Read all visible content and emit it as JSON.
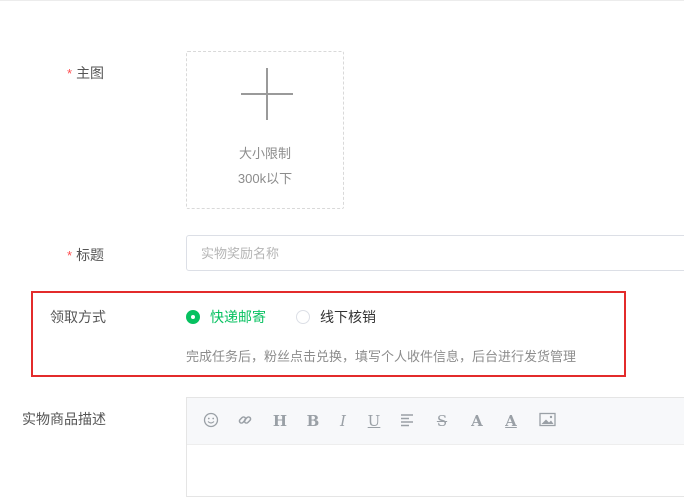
{
  "main_image": {
    "label": "主图",
    "upload": {
      "hint_line1": "大小限制",
      "hint_line2": "300k以下"
    }
  },
  "title_field": {
    "label": "标题",
    "placeholder": "实物奖励名称"
  },
  "claim_method": {
    "label": "领取方式",
    "options": [
      {
        "label": "快递邮寄",
        "selected": true
      },
      {
        "label": "线下核销",
        "selected": false
      }
    ],
    "description": "完成任务后，粉丝点击兑换，填写个人收件信息，后台进行发货管理"
  },
  "description_field": {
    "label": "实物商品描述",
    "toolbar": [
      "emoji-icon",
      "link-icon",
      "heading-icon",
      "bold-icon",
      "italic-icon",
      "underline-icon",
      "align-icon",
      "strikethrough-icon",
      "font-size-icon",
      "font-color-icon",
      "image-icon"
    ],
    "toolbar_glyphs": {
      "heading": "H",
      "bold": "B",
      "italic": "I",
      "underline": "U",
      "strike": "S",
      "fontsize": "A",
      "fontcolor": "A"
    }
  },
  "colors": {
    "accent": "#07c160",
    "required": "#ff4d4f",
    "highlight_border": "#e32b2b"
  }
}
